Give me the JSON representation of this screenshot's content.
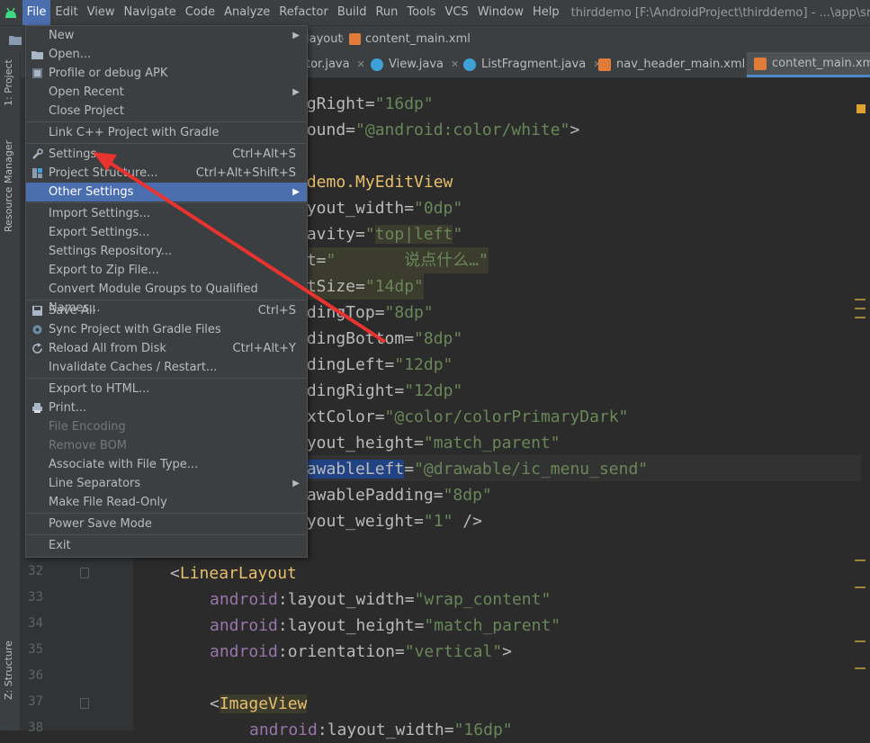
{
  "menubar": {
    "items": [
      "File",
      "Edit",
      "View",
      "Navigate",
      "Code",
      "Analyze",
      "Refactor",
      "Build",
      "Run",
      "Tools",
      "VCS",
      "Window",
      "Help"
    ],
    "title": "thirddemo [F:\\AndroidProject\\thirddemo] - ...\\app\\src\\main"
  },
  "breadcrumbs": [
    "layout",
    "content_main.xml"
  ],
  "tabs": [
    {
      "label": "tor.java",
      "type": "java"
    },
    {
      "label": "View.java",
      "type": "java"
    },
    {
      "label": "ListFragment.java",
      "type": "java"
    },
    {
      "label": "nav_header_main.xml",
      "type": "xml"
    },
    {
      "label": "content_main.xml",
      "type": "xml",
      "active": true
    }
  ],
  "side_panels": [
    "1: Project",
    "Resource Manager",
    "Z: Structure"
  ],
  "accent": "#4b6eaf",
  "arrow_color": "#e8332e",
  "line_numbers": [
    "32",
    "33",
    "34",
    "35",
    "36",
    "37",
    "38"
  ],
  "code": {
    "l1a": "ngRight=",
    "l1b": "\"16dp\"",
    "l2a": "round=",
    "l2b": "\"@android:color/white\"",
    "l2c": ">",
    "l3": "ldemo.MyEditView",
    "l4a": "ayout_width=",
    "l4b": "\"0dp\"",
    "l5a": "ravity=",
    "l5b": "\"",
    "l5c": "top|left",
    "l5d": "\"",
    "l6a": "nt=",
    "l6b": "\"       说点什么…\"",
    "l7a": "xtSize=",
    "l7b": "\"14dp\"",
    "l8a": "ddingTop=",
    "l8b": "\"8dp\"",
    "l9a": "ddingBottom=",
    "l9b": "\"8dp\"",
    "l10a": "ddingLeft=",
    "l10b": "\"12dp\"",
    "l11a": "ddingRight=",
    "l11b": "\"12dp\"",
    "l12a": "extColor=",
    "l12b": "\"@color/colorPrimaryDark\"",
    "l13a": "ayout_height=",
    "l13b": "\"match_parent\"",
    "l14a": "rawableLeft",
    "l14eq": "=",
    "l14b": "\"@drawable/ic_menu_send\"",
    "l15a": "rawablePadding=",
    "l15b": "\"8dp\"",
    "l16a": "ayout_weight=",
    "l16b": "\"1\"",
    "l16c": " />",
    "l32a": "<",
    "l32b": "LinearLayout",
    "ns": "android",
    "colon": ":",
    "l33a": "layout_width=",
    "l33b": "\"wrap_content\"",
    "l34a": "layout_height=",
    "l34b": "\"match_parent\"",
    "l35a": "orientation=",
    "l35b": "\"vertical\"",
    "l35c": ">",
    "l37a": "<",
    "l37b": "ImageView",
    "l38a": "layout_width=",
    "l38b": "\"16dp\""
  },
  "file_menu": {
    "items": [
      {
        "label": "New",
        "submenu": true
      },
      {
        "label": "Open...",
        "icon": "folder-icon"
      },
      {
        "label": "Profile or debug APK",
        "icon": "apk-icon"
      },
      {
        "label": "Open Recent",
        "submenu": true
      },
      {
        "label": "Close Project"
      },
      {
        "label": "Link C++ Project with Gradle"
      },
      {
        "label": "Settings...",
        "shortcut": "Ctrl+Alt+S",
        "icon": "wrench-icon"
      },
      {
        "label": "Project Structure...",
        "shortcut": "Ctrl+Alt+Shift+S",
        "icon": "project-structure-icon"
      },
      {
        "label": "Other Settings",
        "submenu": true,
        "hover": true
      },
      {
        "label": "Import Settings..."
      },
      {
        "label": "Export Settings..."
      },
      {
        "label": "Settings Repository..."
      },
      {
        "label": "Export to Zip File..."
      },
      {
        "label": "Convert Module Groups to Qualified Names..."
      },
      {
        "label": "Save All",
        "shortcut": "Ctrl+S",
        "icon": "save-icon"
      },
      {
        "label": "Sync Project with Gradle Files",
        "icon": "sync-icon"
      },
      {
        "label": "Reload All from Disk",
        "shortcut": "Ctrl+Alt+Y",
        "icon": "reload-icon"
      },
      {
        "label": "Invalidate Caches / Restart..."
      },
      {
        "label": "Export to HTML..."
      },
      {
        "label": "Print...",
        "icon": "print-icon"
      },
      {
        "label": "File Encoding",
        "disabled": true
      },
      {
        "label": "Remove BOM",
        "disabled": true
      },
      {
        "label": "Associate with File Type..."
      },
      {
        "label": "Line Separators",
        "submenu": true
      },
      {
        "label": "Make File Read-Only"
      },
      {
        "label": "Power Save Mode"
      },
      {
        "label": "Exit"
      }
    ]
  }
}
